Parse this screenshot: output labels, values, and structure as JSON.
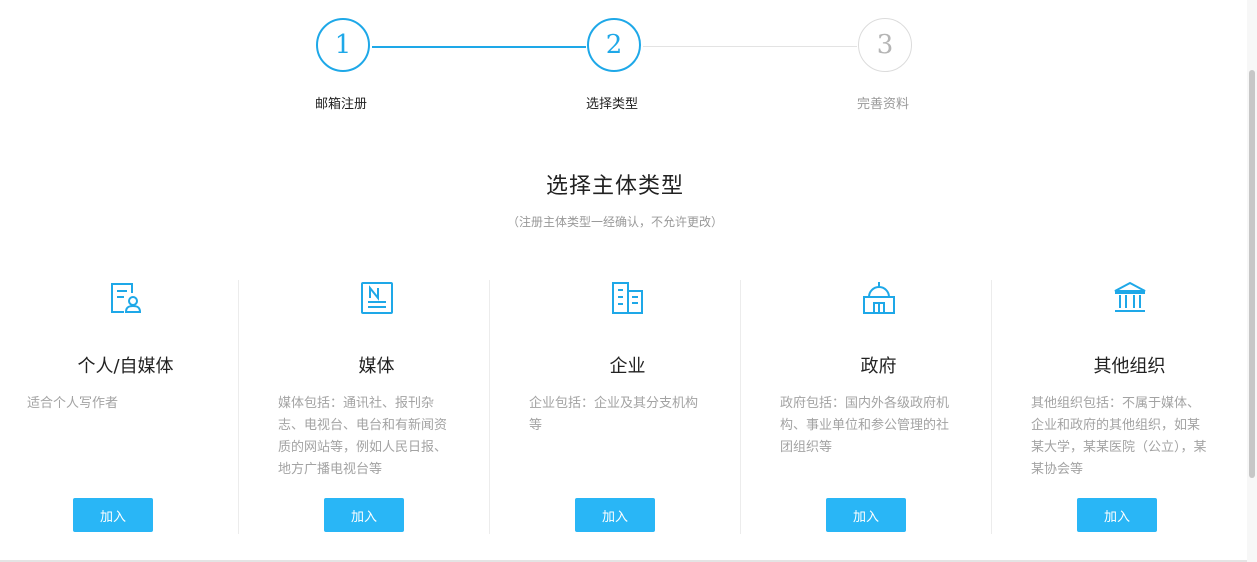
{
  "steps": [
    {
      "number": "1",
      "label": "邮箱注册",
      "state": "done"
    },
    {
      "number": "2",
      "label": "选择类型",
      "state": "current"
    },
    {
      "number": "3",
      "label": "完善资料",
      "state": "pending"
    }
  ],
  "heading": {
    "title": "选择主体类型",
    "subtitle": "（注册主体类型一经确认，不允许更改）"
  },
  "cards": [
    {
      "icon": "person-document-icon",
      "title": "个人/自媒体",
      "desc": "适合个人写作者",
      "button": "加入"
    },
    {
      "icon": "newspaper-icon",
      "title": "媒体",
      "desc": "媒体包括：通讯社、报刊杂志、电视台、电台和有新闻资质的网站等，例如人民日报、地方广播电视台等",
      "button": "加入"
    },
    {
      "icon": "building-icon",
      "title": "企业",
      "desc": "企业包括：企业及其分支机构等",
      "button": "加入"
    },
    {
      "icon": "government-building-icon",
      "title": "政府",
      "desc": "政府包括：国内外各级政府机构、事业单位和参公管理的社团组织等",
      "button": "加入"
    },
    {
      "icon": "institution-icon",
      "title": "其他组织",
      "desc": "其他组织包括：不属于媒体、企业和政府的其他组织，如某某大学，某某医院（公立），某某协会等",
      "button": "加入"
    }
  ],
  "colors": {
    "accent": "#1ea8e8",
    "button": "#29b6f6",
    "inactive": "#b5b5b5"
  }
}
